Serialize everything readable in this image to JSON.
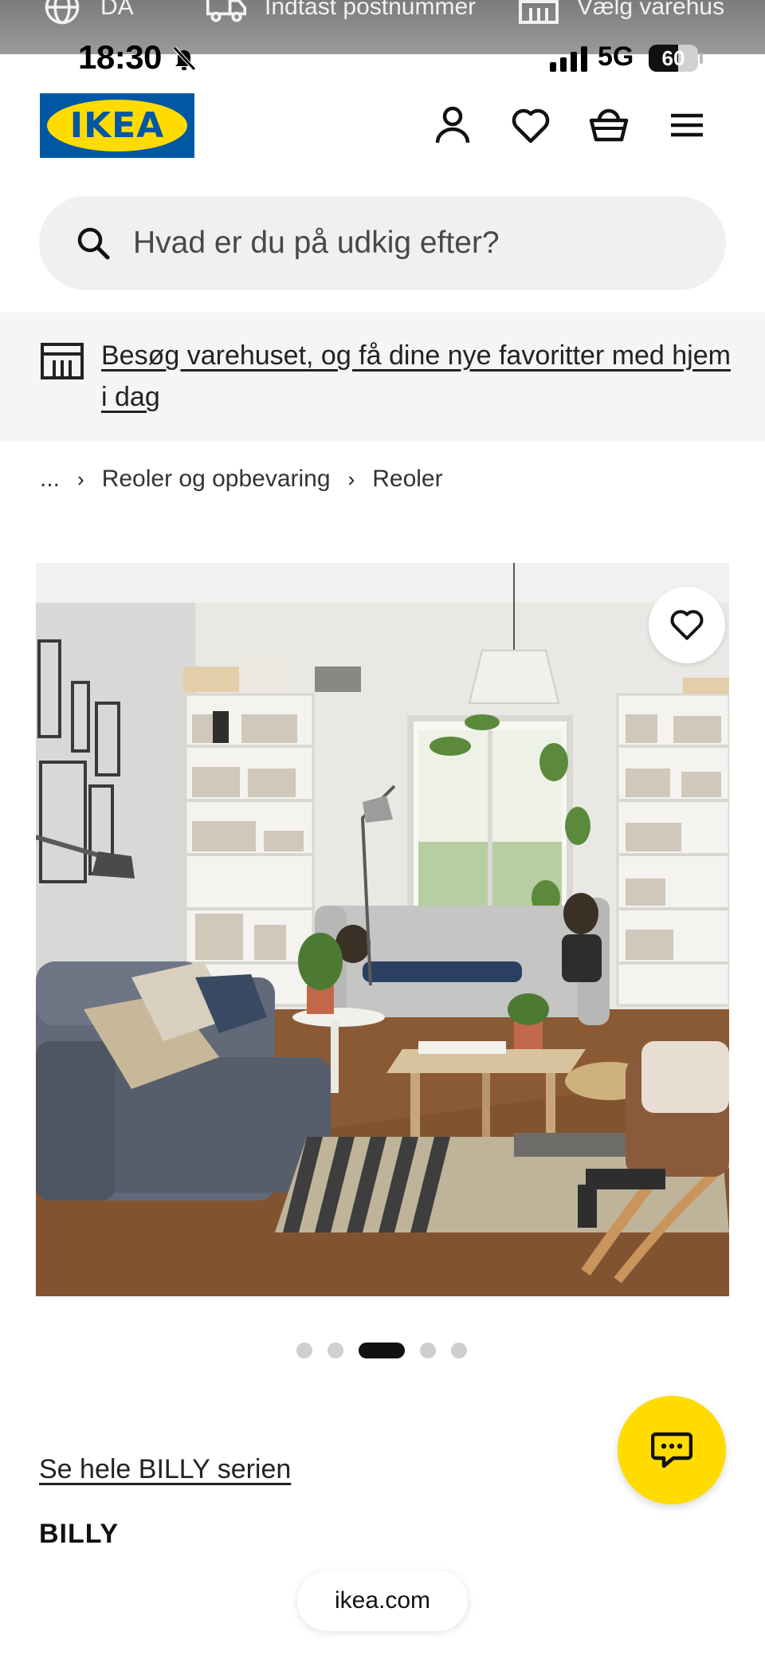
{
  "topbar": {
    "language": "DA",
    "postcode_placeholder": "Indtast postnummer",
    "store_label": "Vælg varehus"
  },
  "status_bar": {
    "time": "18:30",
    "network": "5G",
    "battery": "60",
    "battery_level": 0.6
  },
  "header": {
    "logo_text": "IKEA",
    "icons": [
      "user-icon",
      "heart-icon",
      "basket-icon",
      "menu-icon"
    ]
  },
  "search": {
    "placeholder": "Hvad er du på udkig efter?"
  },
  "store_banner": {
    "text": "Besøg varehuset, og få dine nye favoritter med hjem i dag"
  },
  "breadcrumb": {
    "ellipsis": "...",
    "items": [
      "Reoler og opbevaring",
      "Reoler"
    ]
  },
  "gallery": {
    "image_count": 5,
    "active_index": 2
  },
  "product": {
    "series_link": "Se hele BILLY serien",
    "name": "BILLY"
  },
  "browser": {
    "url": "ikea.com"
  },
  "colors": {
    "ikea_blue": "#0058a3",
    "ikea_yellow": "#ffdb00",
    "banner_bg": "#f5f5f5",
    "search_bg": "#f0f0f0"
  }
}
